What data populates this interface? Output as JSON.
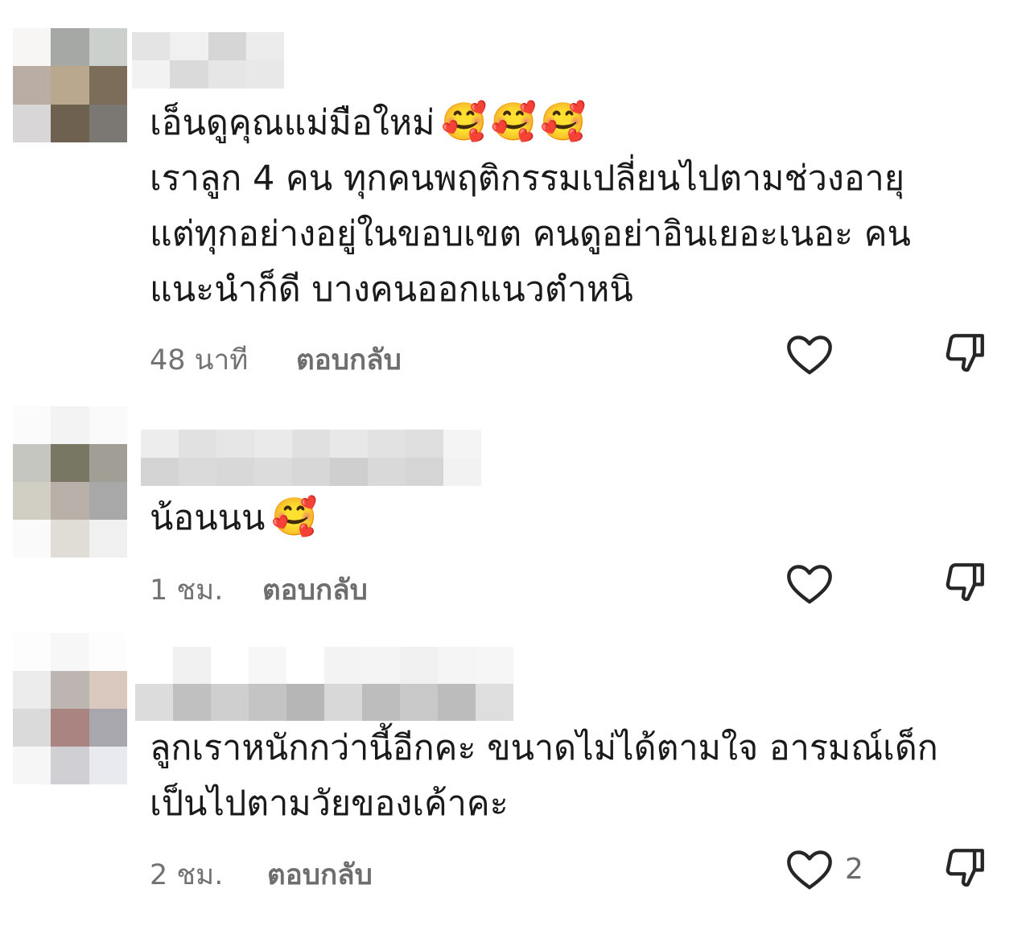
{
  "comments": [
    {
      "text_lines": [
        "เอ็นดูคุณแม่มือใหม่",
        "เราลูก 4 คน ทุกคนพฤติกรรมเปลี่ยนไปตามช่วงอายุ",
        "แต่ทุกอย่างอยู่ในขอบเขต คนดูอย่าอินเยอะเนอะ คน",
        "แนะนำก็ดี บางคนออกแนวตำหนิ"
      ],
      "emojis": "🥰🥰🥰",
      "time": "48 นาที",
      "reply_label": "ตอบกลับ",
      "likes": ""
    },
    {
      "text_lines": [
        "น้อนนน"
      ],
      "emojis": "🥰",
      "time": "1 ชม.",
      "reply_label": "ตอบกลับ",
      "likes": ""
    },
    {
      "text_lines": [
        "ลูกเราหนักกว่านี้อีกคะ ขนาดไม่ได้ตามใจ อารมณ์เด็ก",
        "เป็นไปตามวัยของเค้าคะ"
      ],
      "emojis": "",
      "time": "2 ชม.",
      "reply_label": "ตอบกลับ",
      "likes": "2"
    }
  ],
  "icons": {
    "like": "heart-outline-icon",
    "dislike": "thumbs-down-outline-icon"
  },
  "colors": {
    "text": "#1a1a1a",
    "meta": "#737373",
    "icon": "#262626"
  }
}
